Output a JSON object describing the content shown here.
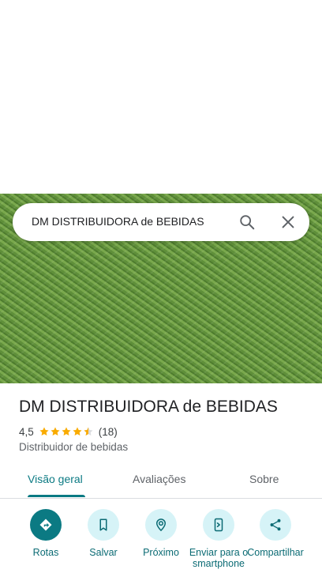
{
  "place": {
    "name": "DM DISTRIBUIDORA de BEBIDAS",
    "rating": "4,5",
    "rating_stars": 4.5,
    "review_count": "(18)",
    "category": "Distribuidor de bebidas"
  },
  "search": {
    "query": "DM DISTRIBUIDORA de BEBIDAS",
    "search_icon": "search-icon",
    "close_icon": "close-icon"
  },
  "tabs": [
    {
      "label": "Visão geral",
      "active": true
    },
    {
      "label": "Avaliações",
      "active": false
    },
    {
      "label": "Sobre",
      "active": false
    }
  ],
  "actions": [
    {
      "label": "Rotas",
      "icon": "directions-icon"
    },
    {
      "label": "Salvar",
      "icon": "bookmark-icon"
    },
    {
      "label": "Próximo",
      "icon": "nearby-icon"
    },
    {
      "label": "Enviar para o smartphone",
      "icon": "send-to-phone-icon"
    },
    {
      "label": "Compartilhar",
      "icon": "share-icon"
    }
  ],
  "colors": {
    "accent": "#0b7a83",
    "action_bg": "#d6f3f7",
    "star": "#f9ab00"
  }
}
